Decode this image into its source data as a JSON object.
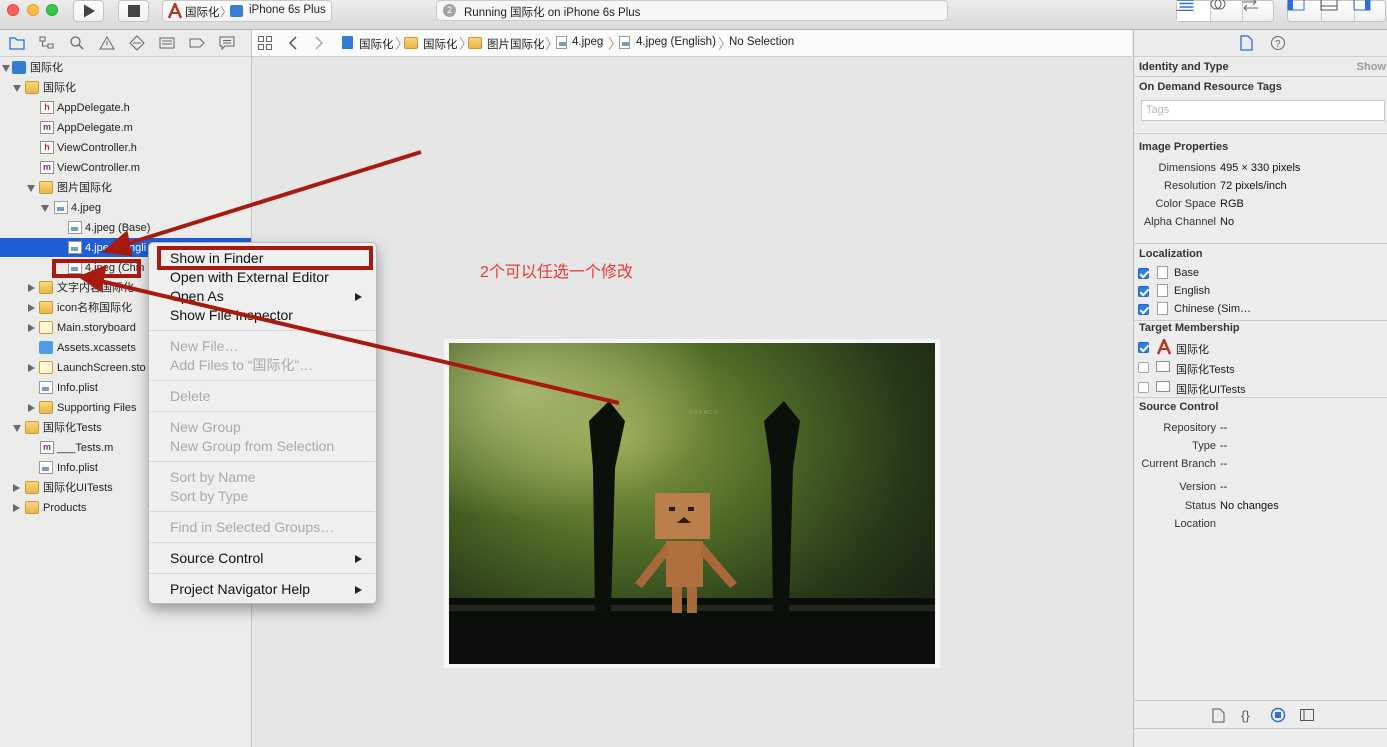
{
  "toolbar": {
    "scheme_project": "国际化",
    "scheme_device": "iPhone 6s Plus",
    "status_badge": "2",
    "status_text": "Running 国际化 on iPhone 6s Plus"
  },
  "jumpbar": {
    "crumbs": [
      "国际化",
      "国际化",
      "图片国际化",
      "4.jpeg",
      "4.jpeg (English)",
      "No Selection"
    ]
  },
  "navigator": {
    "items": [
      {
        "label": "国际化"
      },
      {
        "label": "国际化"
      },
      {
        "label": "AppDelegate.h",
        "icon": "h"
      },
      {
        "label": "AppDelegate.m",
        "icon": "m"
      },
      {
        "label": "ViewController.h",
        "icon": "h"
      },
      {
        "label": "ViewController.m",
        "icon": "m"
      },
      {
        "label": "图片国际化"
      },
      {
        "label": "4.jpeg"
      },
      {
        "label": "4.jpeg (Base)"
      },
      {
        "label": "4.jpeg (Engli"
      },
      {
        "label": "4.jpeg (Chin"
      },
      {
        "label": "文字内容国际化"
      },
      {
        "label": "icon名称国际化"
      },
      {
        "label": "Main.storyboard"
      },
      {
        "label": "Assets.xcassets"
      },
      {
        "label": "LaunchScreen.sto"
      },
      {
        "label": "Info.plist"
      },
      {
        "label": "Supporting Files"
      },
      {
        "label": "国际化Tests"
      },
      {
        "label": "___Tests.m",
        "icon": "m"
      },
      {
        "label": "Info.plist"
      },
      {
        "label": "国际化UITests"
      },
      {
        "label": "Products"
      }
    ]
  },
  "context_menu": {
    "show_in_finder": "Show in Finder",
    "open_external": "Open with External Editor",
    "open_as": "Open As",
    "show_file_inspector": "Show File Inspector",
    "new_file": "New File…",
    "add_files": "Add Files to “国际化”…",
    "delete": "Delete",
    "new_group": "New Group",
    "new_group_selection": "New Group from Selection",
    "sort_name": "Sort by Name",
    "sort_type": "Sort by Type",
    "find_selected": "Find in Selected Groups…",
    "source_control": "Source Control",
    "nav_help": "Project Navigator Help"
  },
  "annotation": "2个可以任选一个修改",
  "photo": {
    "watermark": "DRENCH"
  },
  "inspector": {
    "identity_title": "Identity and Type",
    "identity_show": "Show",
    "odr_title": "On Demand Resource Tags",
    "tags_placeholder": "Tags",
    "image_props_title": "Image Properties",
    "dimensions_label": "Dimensions",
    "dimensions_value": "495 × 330 pixels",
    "resolution_label": "Resolution",
    "resolution_value": "72 pixels/inch",
    "colorspace_label": "Color Space",
    "colorspace_value": "RGB",
    "alpha_label": "Alpha Channel",
    "alpha_value": "No",
    "localization_title": "Localization",
    "loc_base": "Base",
    "loc_english": "English",
    "loc_chinese": "Chinese (Sim…",
    "target_title": "Target Membership",
    "target_app": "国际化",
    "target_tests": "国际化Tests",
    "target_uitests": "国际化UITests",
    "sc_title": "Source Control",
    "repo_label": "Repository",
    "repo_value": "--",
    "type_label": "Type",
    "type_value": "--",
    "branch_label": "Current Branch",
    "branch_value": "--",
    "version_label": "Version",
    "version_value": "--",
    "status_label": "Status",
    "status_value": "No changes",
    "location_label": "Location"
  },
  "colors": {
    "accent": "#1f5fd6",
    "annotation": "#e53a30",
    "arrow": "#a8190f"
  }
}
